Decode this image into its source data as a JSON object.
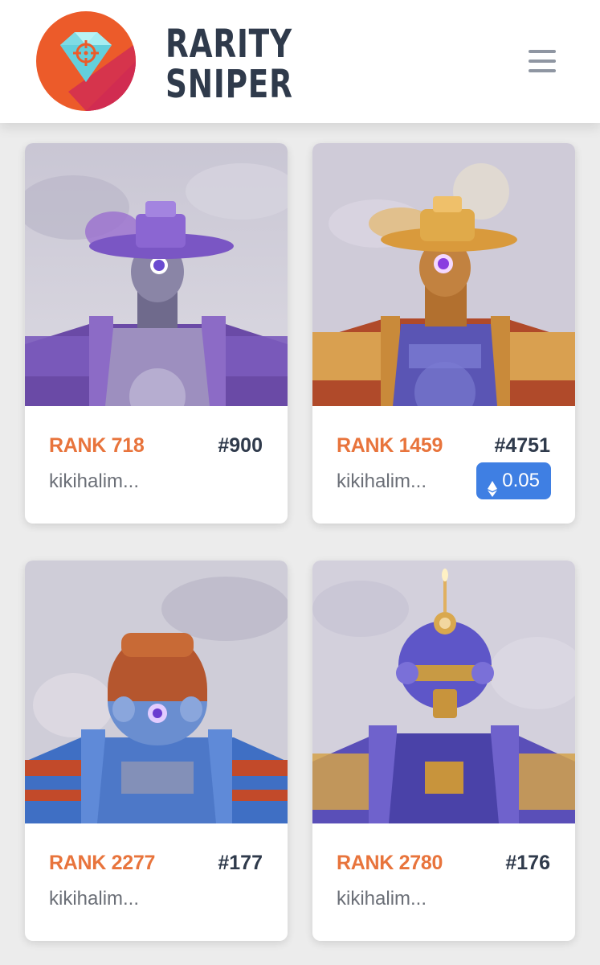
{
  "header": {
    "brand_line1": "RARITY",
    "brand_line2": "SNIPER",
    "menu_icon": "hamburger-menu-icon",
    "logo_icon": "diamond-crosshair-logo-icon"
  },
  "colors": {
    "rank": "#e8743c",
    "token_id": "#2f3a4b",
    "owner": "#6b6f77",
    "price_badge": "#3f7fe3",
    "background": "#ececec"
  },
  "cards": [
    {
      "rank": "RANK 718",
      "token_id": "#900",
      "owner": "kikihalim...",
      "price": ""
    },
    {
      "rank": "RANK 1459",
      "token_id": "#4751",
      "owner": "kikihalim...",
      "price": "0.05",
      "price_icon": "ethereum-icon"
    },
    {
      "rank": "RANK 2277",
      "token_id": "#177",
      "owner": "kikihalim...",
      "price": ""
    },
    {
      "rank": "RANK 2780",
      "token_id": "#176",
      "owner": "kikihalim...",
      "price": ""
    }
  ]
}
